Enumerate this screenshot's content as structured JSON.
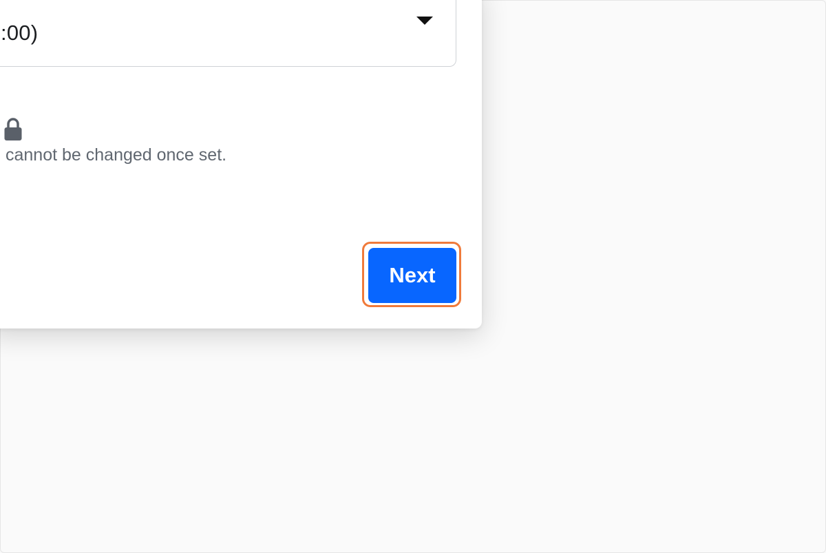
{
  "dialog": {
    "select": {
      "value": ":00)",
      "icon": "caret-down-icon"
    },
    "lock": {
      "icon": "lock-icon",
      "note": "cannot be changed once set."
    },
    "footer": {
      "next_label": "Next"
    }
  },
  "colors": {
    "accent": "#0866ff",
    "focus_ring": "#f07a3a",
    "text_primary": "#1c1e21",
    "text_secondary": "#606770",
    "icon": "#5a6069",
    "page_background": "#fafafa"
  }
}
